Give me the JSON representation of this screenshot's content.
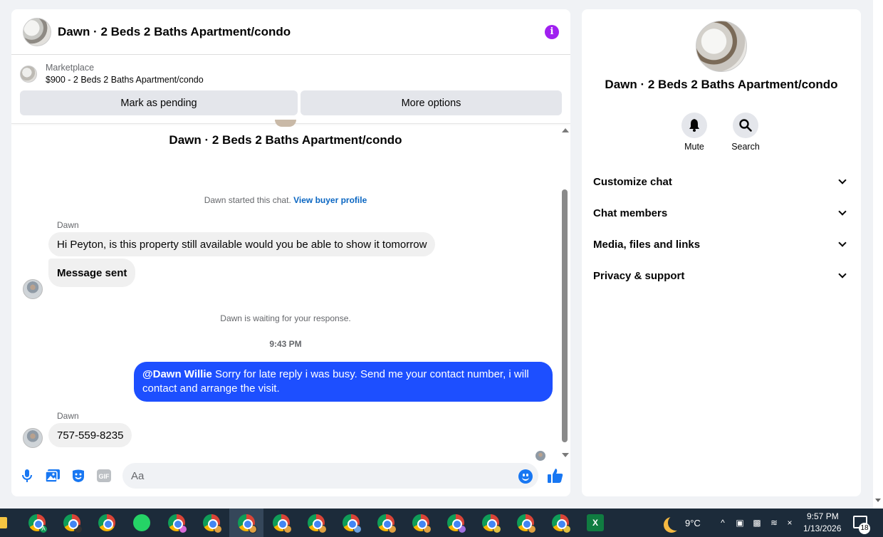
{
  "header": {
    "title": "Dawn · 2 Beds 2 Baths Apartment/condo",
    "info_icon": "i"
  },
  "listing": {
    "label": "Marketplace",
    "price_title": "$900 - 2 Beds 2 Baths Apartment/condo"
  },
  "actions": {
    "pending_label": "Mark as pending",
    "more_label": "More options"
  },
  "conversation": {
    "title": "Dawn · 2 Beds 2 Baths Apartment/condo",
    "started_text": "Dawn started this chat.",
    "buyer_link": "View buyer profile",
    "waiting_text": "Dawn is waiting for your response.",
    "time": "9:43 PM",
    "messages": [
      {
        "sender": "Dawn",
        "text": "Hi Peyton, is this  property still available would you be able to show it tomorrow"
      },
      {
        "text": "Message sent"
      },
      {
        "mention": "@Dawn Willie",
        "text": " Sorry for late reply i was busy. Send me your contact number, i will contact and arrange the visit."
      },
      {
        "sender": "Dawn",
        "text": "757-559-8235"
      }
    ]
  },
  "composer": {
    "placeholder": "Aa",
    "gif_label": "GIF"
  },
  "info_panel": {
    "title": "Dawn · 2 Beds 2 Baths Apartment/condo",
    "mute_label": "Mute",
    "search_label": "Search",
    "sections": [
      "Customize chat",
      "Chat members",
      "Media, files and links",
      "Privacy & support"
    ]
  },
  "taskbar": {
    "weather": "9°C",
    "time": "9:57 PM",
    "date": "1/13/2026",
    "notification_count": "18",
    "excel_label": "X",
    "chrome_badge_letter": "A"
  },
  "colors": {
    "accent_blue": "#1d4fff",
    "info_purple": "#a020f0",
    "link_blue": "#0a66c2"
  }
}
